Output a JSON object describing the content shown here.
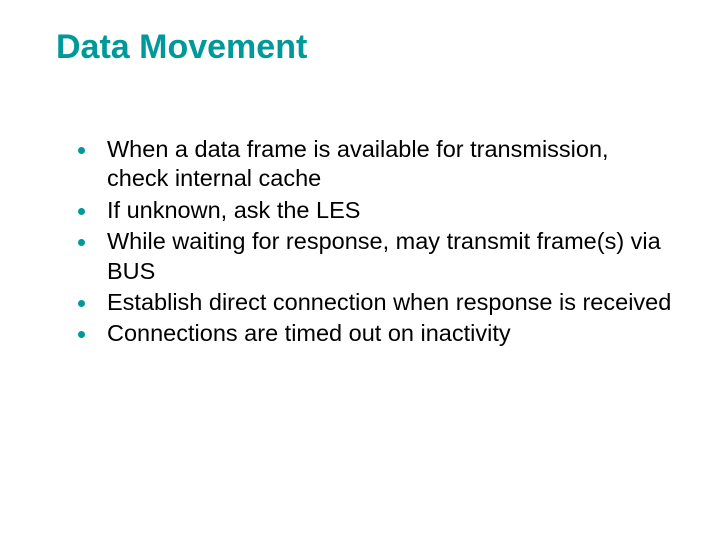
{
  "title": "Data Movement",
  "bullets": [
    "When a data frame is available for transmission, check internal cache",
    "If unknown, ask the LES",
    "While waiting for response, may transmit frame(s) via BUS",
    "Establish direct connection when response is received",
    "Connections are timed out on inactivity"
  ]
}
